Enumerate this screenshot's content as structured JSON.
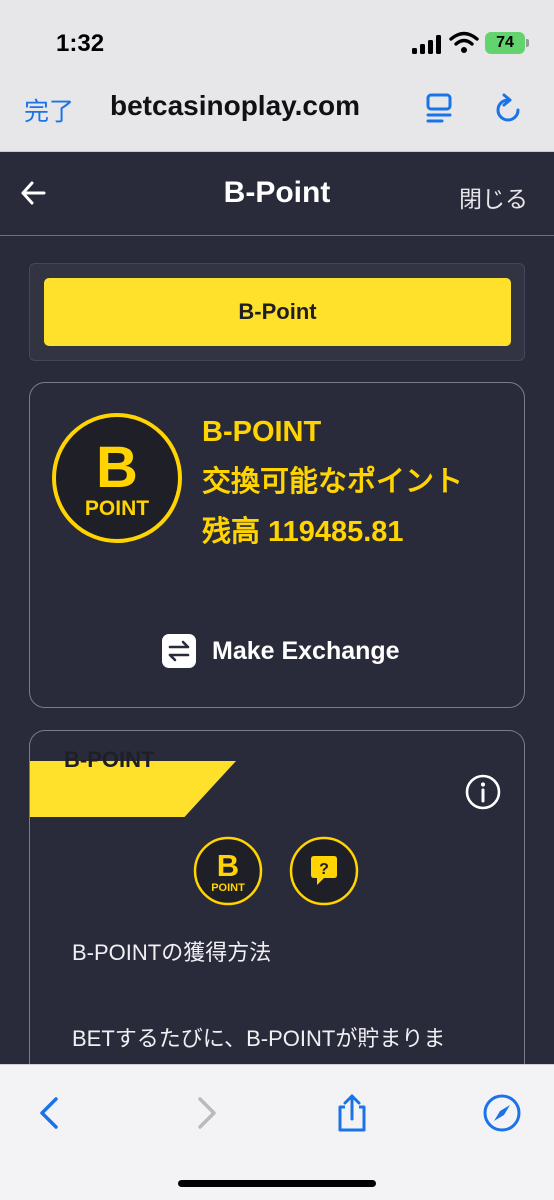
{
  "status_bar": {
    "time": "1:32",
    "battery": "74"
  },
  "browser": {
    "done_label": "完了",
    "url": "betcasinoplay.com",
    "accent_color": "#1a73e8"
  },
  "modal": {
    "title": "B-Point",
    "close_label": "閉じる"
  },
  "tabs": [
    {
      "label": "B-Point",
      "active": true
    }
  ],
  "balance_card": {
    "logo_letter": "B",
    "logo_word": "POINT",
    "name": "B-POINT",
    "exchangeable_label": "交換可能なポイント",
    "balance_line": "残高 119485.81",
    "exchange_label": "Make Exchange",
    "accent_color": "#ffd400"
  },
  "info_card": {
    "ribbon_label": "B-POINT",
    "logo_letter": "B",
    "logo_word": "POINT",
    "heading": "B-POINTの獲得方法",
    "body": "BETするたびに、B-POINTが貯まりま"
  },
  "icons": {
    "back": "back-arrow-icon",
    "info": "info-icon",
    "help": "question-bubble-icon",
    "exchange": "exchange-arrows-icon",
    "reader": "reader-icon",
    "reload": "reload-icon",
    "toolbar": [
      "back-icon",
      "forward-icon",
      "share-icon",
      "compass-icon"
    ]
  }
}
